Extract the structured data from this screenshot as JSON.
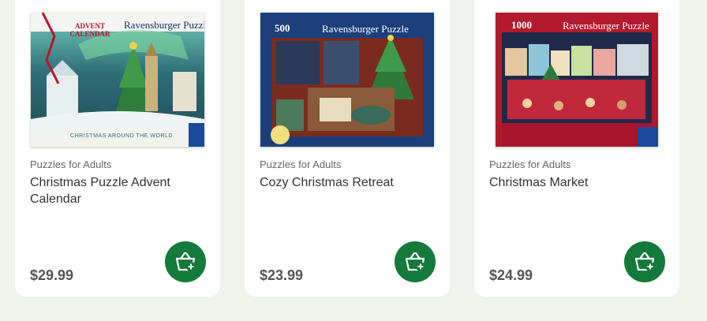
{
  "products": [
    {
      "category": "Puzzles for Adults",
      "title": "Christmas Puzzle Advent Calendar",
      "price": "$29.99",
      "image": {
        "brand": "Ravensburger Puzzle",
        "tag": "ADVENT CALENDAR",
        "subtitle": "CHRISTMAS AROUND THE WORLD"
      }
    },
    {
      "category": "Puzzles for Adults",
      "title": "Cozy Christmas Retreat",
      "price": "$23.99",
      "image": {
        "brand": "Ravensburger Puzzle",
        "pieces": "500"
      }
    },
    {
      "category": "Puzzles for Adults",
      "title": "Christmas Market",
      "price": "$24.99",
      "image": {
        "brand": "Ravensburger Puzzle",
        "pieces": "1000"
      }
    }
  ],
  "icons": {
    "cart": "basket-add-icon"
  },
  "colors": {
    "page_bg": "#eef3ec",
    "card_bg": "#ffffff",
    "cart_button": "#137a3a"
  }
}
